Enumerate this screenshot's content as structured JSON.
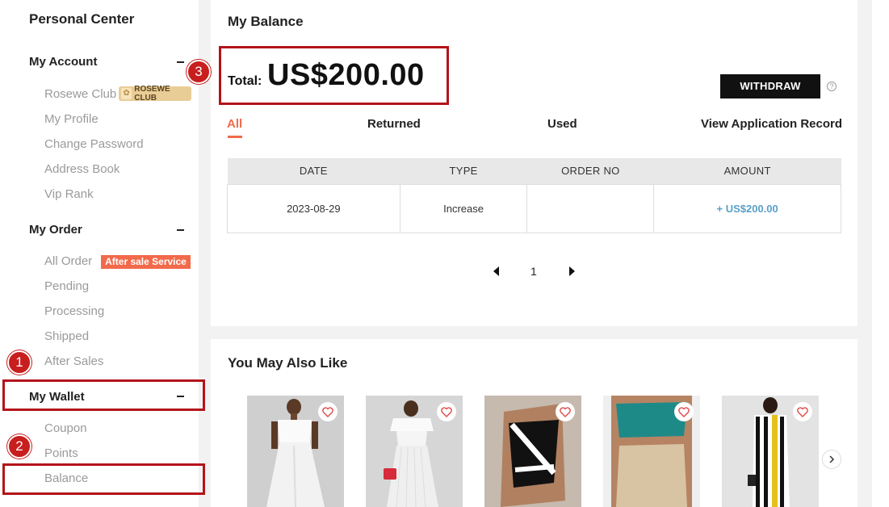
{
  "sidebar": {
    "title": "Personal Center",
    "my_account": {
      "label": "My Account",
      "items": [
        "Rosewe Club",
        "My Profile",
        "Change Password",
        "Address Book",
        "Vip Rank"
      ],
      "club_badge": "ROSEWE CLUB"
    },
    "my_order": {
      "label": "My Order",
      "items": [
        "All Order",
        "Pending",
        "Processing",
        "Shipped",
        "After Sales"
      ],
      "after_sale_badge": "After sale Service"
    },
    "my_wallet": {
      "label": "My Wallet",
      "items": [
        "Coupon",
        "Points",
        "Balance"
      ]
    }
  },
  "annotations": [
    "1",
    "2",
    "3"
  ],
  "balance": {
    "title": "My Balance",
    "total_label": "Total:",
    "total_value": "US$200.00",
    "withdraw_label": "WITHDRAW",
    "help_glyph": "?",
    "tabs": [
      "All",
      "Returned",
      "Used",
      "View Application Record"
    ],
    "table": {
      "headers": [
        "DATE",
        "TYPE",
        "ORDER NO",
        "AMOUNT"
      ],
      "rows": [
        {
          "date": "2023-08-29",
          "type": "Increase",
          "order_no": "",
          "amount": "+ US$200.00"
        }
      ]
    },
    "pager": {
      "current": "1"
    }
  },
  "recommend": {
    "title": "You May Also Like",
    "products": [
      "white-asymmetric-jumpsuit",
      "white-pleated-dress",
      "black-white-swimsuit",
      "teal-shapewear",
      "striped-bodycon-dress"
    ]
  },
  "colors": {
    "accent": "#f26a4b",
    "annotation": "#c81e1e",
    "amount": "#5aa0c8"
  }
}
